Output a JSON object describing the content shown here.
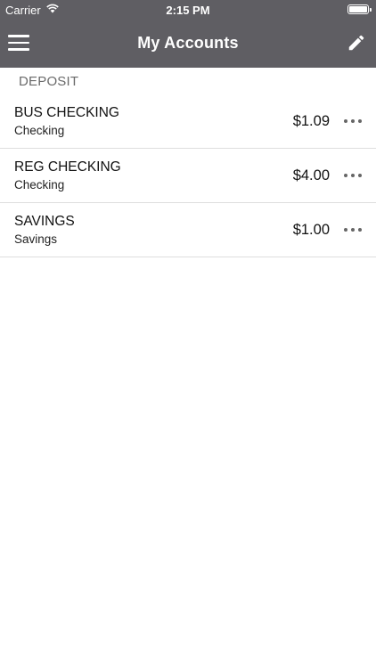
{
  "status_bar": {
    "carrier": "Carrier",
    "time": "2:15 PM",
    "wifi_icon": "wifi-icon",
    "battery_icon": "battery-icon"
  },
  "nav": {
    "title": "My Accounts",
    "menu_icon": "hamburger-menu-icon",
    "edit_icon": "pencil-icon",
    "background": "#5f5e63"
  },
  "section": {
    "header": "DEPOSIT"
  },
  "accounts": [
    {
      "name": "BUS CHECKING",
      "type": "Checking",
      "balance": "$1.09"
    },
    {
      "name": "REG CHECKING",
      "type": "Checking",
      "balance": "$4.00"
    },
    {
      "name": "SAVINGS",
      "type": "Savings",
      "balance": "$1.00"
    }
  ]
}
